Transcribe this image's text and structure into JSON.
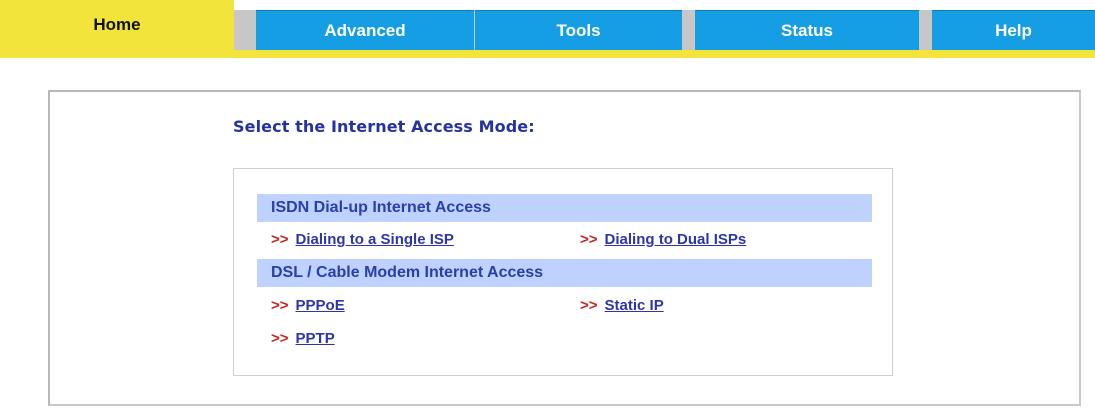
{
  "nav": {
    "tabs": [
      {
        "label": "Home"
      },
      {
        "label": "Advanced"
      },
      {
        "label": "Tools"
      },
      {
        "label": "Status"
      },
      {
        "label": "Help"
      }
    ]
  },
  "main": {
    "title": "Select the Internet Access Mode:",
    "sections": [
      {
        "header": "ISDN Dial-up Internet Access",
        "options": [
          {
            "arrow": ">>",
            "label": "Dialing to a Single ISP"
          },
          {
            "arrow": ">>",
            "label": "Dialing to Dual ISPs"
          }
        ]
      },
      {
        "header": "DSL / Cable Modem Internet Access",
        "options": [
          {
            "arrow": ">>",
            "label": "PPPoE"
          },
          {
            "arrow": ">>",
            "label": "Static IP"
          },
          {
            "arrow": ">>",
            "label": "PPTP"
          }
        ]
      }
    ]
  },
  "colors": {
    "nav_yellow": "#f2e43b",
    "nav_blue": "#169ee5",
    "section_header": "#bfd1ff",
    "title_blue": "#2433a0",
    "arrow_red": "#c82222"
  }
}
